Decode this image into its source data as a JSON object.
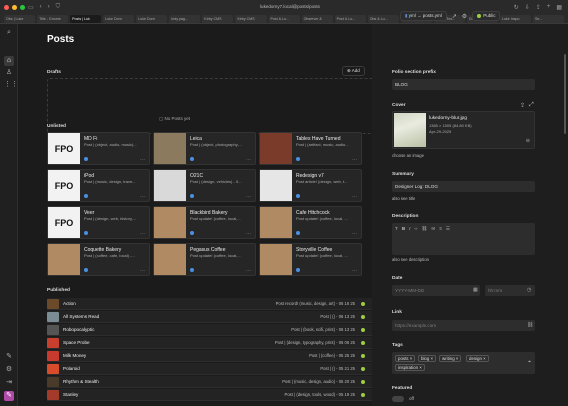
{
  "browser": {
    "url": "lukedorny7.local@posts/posts",
    "tabs": [
      "Obs | Luke",
      "Title - Gnome",
      "Posts | Luk",
      "Luke Dorn",
      "Luke Dorn",
      "Indy.pag...",
      "Kirby CMS",
      "Kirby CMS",
      "Post & Lo...",
      "Observer &",
      "Post & Lo...",
      "Obs & Lu...",
      "Kirby Edito...",
      "Static Res...",
      "Grocerie",
      "Luke Inspo",
      "Se..."
    ]
  },
  "page": {
    "title": "Posts"
  },
  "topbar": {
    "file_label": "yml → posts.yml",
    "public_label": "Public"
  },
  "drafts": {
    "label": "Drafts",
    "add_label": "Add",
    "empty": "No Posts yet"
  },
  "unlisted": {
    "label": "Unlisted",
    "cards": [
      {
        "title": "MD Fi",
        "sub": "Post | (object, audio, music)...",
        "thumb": "FPO"
      },
      {
        "title": "Leica",
        "sub": "Post | (object, photography,...",
        "thumb": "camera"
      },
      {
        "title": "Tables Have Turned",
        "sub": "Post | (artifact, music, audio...",
        "thumb": "record"
      },
      {
        "title": "iPod",
        "sub": "Post | (music, design, trave...",
        "thumb": "FPO"
      },
      {
        "title": "O21C",
        "sub": "Post | (design, vehicles) - 0...",
        "thumb": "car"
      },
      {
        "title": "Redesign v7",
        "sub": "Post article! (design, web, t...",
        "thumb": "doc"
      },
      {
        "title": "Veer",
        "sub": "Post | (design, web, history,...",
        "thumb": "FPO"
      },
      {
        "title": "Blackbird Bakery",
        "sub": "Post update! (coffee, local,...",
        "thumb": "coffee"
      },
      {
        "title": "Cafe Hitchcock",
        "sub": "Post update! (coffee, local, ...",
        "thumb": "coffee"
      },
      {
        "title": "Coquette Bakery",
        "sub": "Post | (coffee, cafe, local) -...",
        "thumb": "coffee"
      },
      {
        "title": "Pegasus Coffee",
        "sub": "Post update! (coffee, local,...",
        "thumb": "coffee"
      },
      {
        "title": "Storyville Coffee",
        "sub": "Post update! (coffee, local, ...",
        "thumb": "coffee"
      }
    ]
  },
  "published": {
    "label": "Published",
    "rows": [
      {
        "title": "Action",
        "meta": "Post record! (music, design, art) - 06 16 25",
        "color": "#6b4a2a"
      },
      {
        "title": "All Systems Read",
        "meta": "Post | () - 06 13 25",
        "color": "#7c8c95"
      },
      {
        "title": "Robopocalyptic",
        "meta": "Post | (book, scifi, print) - 06 13 25",
        "color": "#555"
      },
      {
        "title": "Space Probe",
        "meta": "Post | (design, typography, print) - 06 06 25",
        "color": "#c8402d"
      },
      {
        "title": "Milk Money",
        "meta": "Post | (coffee) - 05 25 25",
        "color": "#c93a2e"
      },
      {
        "title": "Polaroid",
        "meta": "Post | () - 05 21 25",
        "color": "#d84b2b"
      },
      {
        "title": "Rhythm & Stealth",
        "meta": "Post | (music, design, audio) - 05 20 25",
        "color": "#4a3a2a"
      },
      {
        "title": "Stanley",
        "meta": "Post | (design, tools, wood) - 05 19 25",
        "color": "#a33a2a"
      }
    ]
  },
  "panel": {
    "folio_label": "Folio section prefix",
    "folio_value": "BLOG",
    "cover_label": "Cover",
    "cover_file": "lukedorny-blur.jpg",
    "cover_dims": "1365 × 1505 (84.80 KB)",
    "cover_date": "Apr-29-2025",
    "choose_image": "choose an image",
    "summary_label": "Summary",
    "summary_value": "Designer Log: DLOG",
    "summary_link": "also see title",
    "description_label": "Description",
    "description_link": "also see description",
    "date_label": "Date",
    "date_placeholder": "YYYY-MM-DD",
    "time_placeholder": "hh:mm",
    "link_label": "Link",
    "link_placeholder": "https://example.com",
    "tags_label": "Tags",
    "tags": [
      "posts",
      "blog",
      "writing",
      "design",
      "inspiration"
    ],
    "featured_label": "Featured",
    "featured_value": "off"
  }
}
